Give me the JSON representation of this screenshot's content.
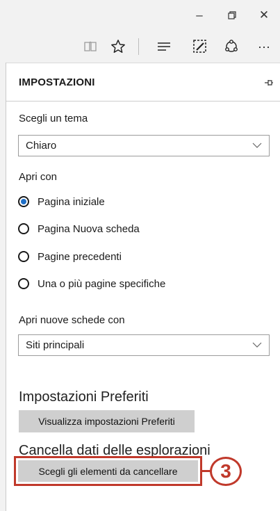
{
  "window": {
    "minimize": "–",
    "restore": "⧉",
    "close": "✕"
  },
  "toolbar": {
    "reading_view": "reading-view-icon",
    "favorite": "star-icon",
    "hub": "hub-icon",
    "web_note": "web-note-icon",
    "share": "share-icon",
    "more": "···"
  },
  "panel": {
    "title": "IMPOSTAZIONI",
    "pin": "⊣⊏",
    "theme_label": "Scegli un tema",
    "theme_value": "Chiaro",
    "open_with_label": "Apri con",
    "open_with_options": [
      {
        "label": "Pagina iniziale",
        "selected": true
      },
      {
        "label": "Pagina Nuova scheda",
        "selected": false
      },
      {
        "label": "Pagine precedenti",
        "selected": false
      },
      {
        "label": "Una o più pagine specifiche",
        "selected": false
      }
    ],
    "new_tabs_label": "Apri nuove schede con",
    "new_tabs_value": "Siti principali",
    "favorites_heading": "Impostazioni Preferiti",
    "favorites_button": "Visualizza impostazioni Preferiti",
    "clear_heading": "Cancella dati delle esplorazioni",
    "clear_button": "Scegli gli elementi da cancellare"
  },
  "callout": {
    "number": "3",
    "color": "#c0392b"
  },
  "colors": {
    "accent": "#1f6fc7",
    "button_bg": "#cfcfcf",
    "highlight": "#c0392b"
  }
}
